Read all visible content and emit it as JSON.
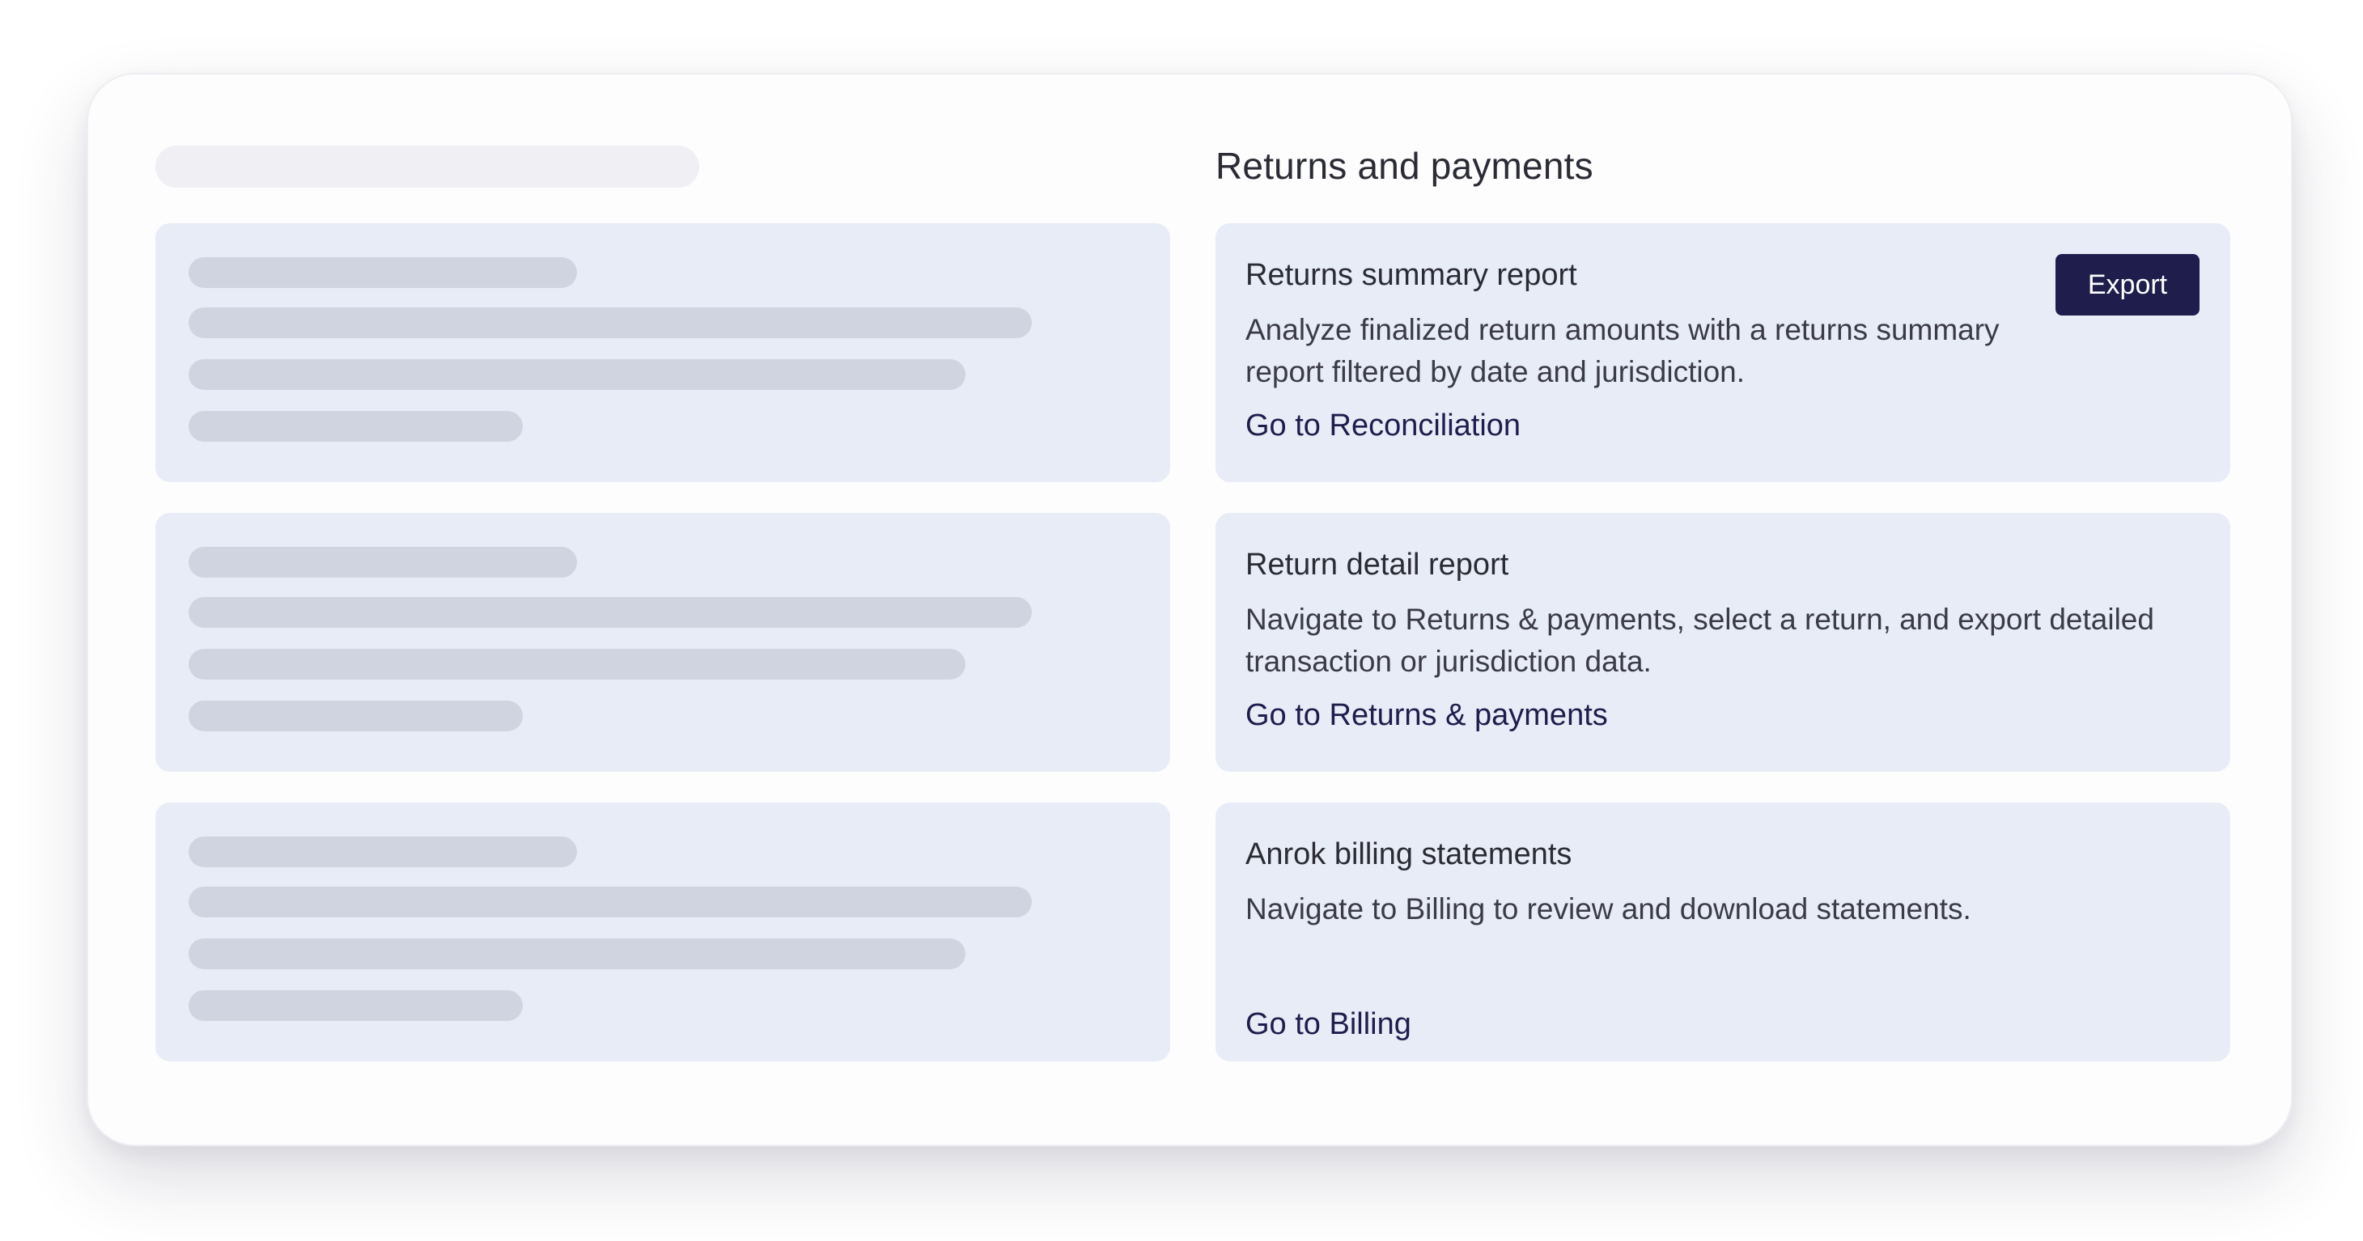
{
  "section": {
    "title": "Returns and payments"
  },
  "cards": [
    {
      "title": "Returns summary report",
      "description": "Analyze finalized return amounts with a returns summary report filtered by date and jurisdiction.",
      "link": "Go to Reconciliation",
      "button": "Export"
    },
    {
      "title": "Return detail report",
      "description": "Navigate to Returns & payments, select a return, and export detailed transaction or jurisdiction data.",
      "link": "Go to Returns & payments"
    },
    {
      "title": "Anrok billing statements",
      "description": "Navigate to Billing to review and download statements.",
      "link": "Go to Billing"
    }
  ],
  "colors": {
    "accent": "#1e1d4c",
    "card_background": "#e8ecf7",
    "skeleton": "#d0d4e0"
  }
}
